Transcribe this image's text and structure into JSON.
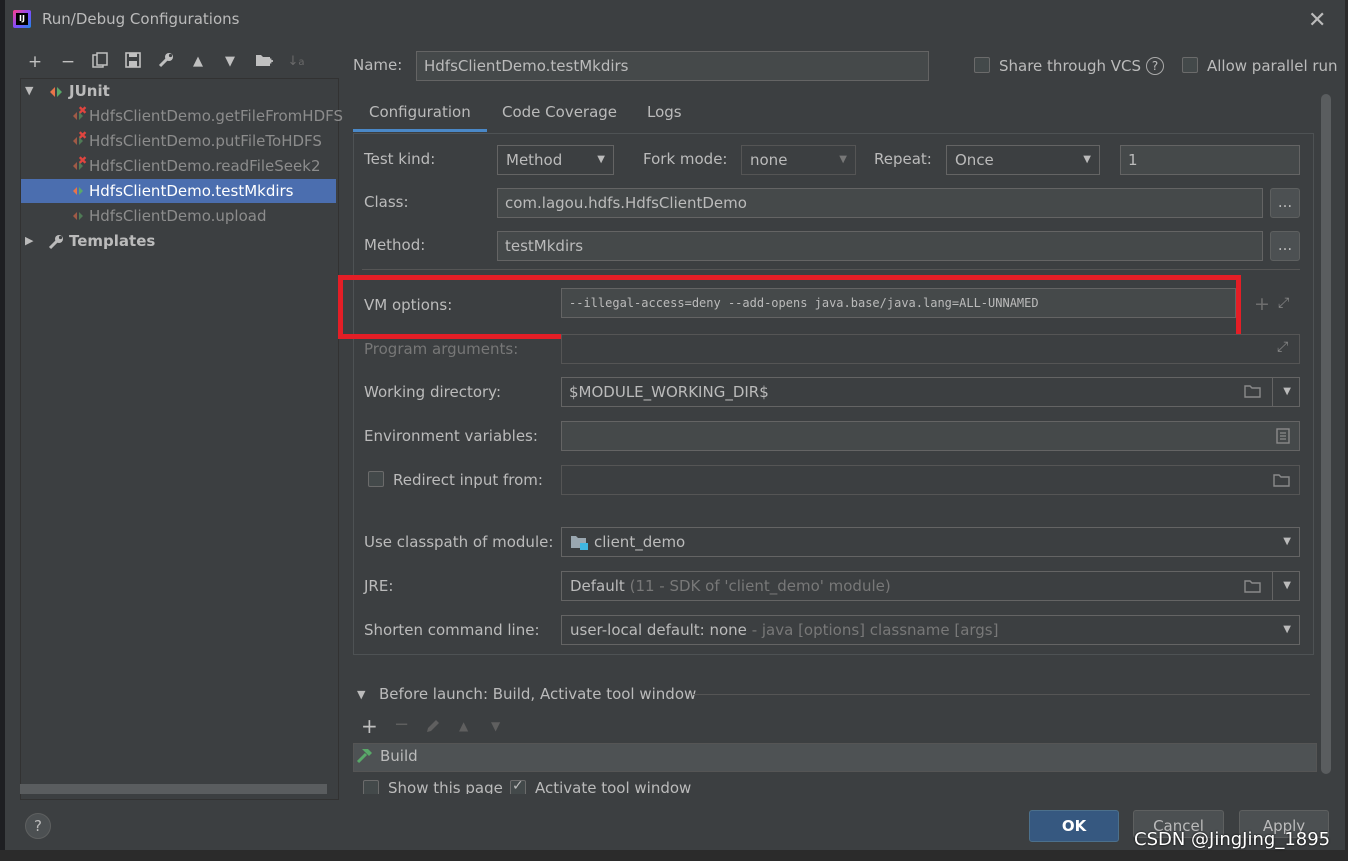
{
  "window": {
    "title": "Run/Debug Configurations",
    "icon": "intellij-idea-icon"
  },
  "toolbar": {
    "icons": [
      "add-icon",
      "remove-icon",
      "copy-icon",
      "save-icon",
      "wrench-icon",
      "move-up-icon",
      "move-down-icon",
      "folder-add-icon",
      "sort-icon"
    ],
    "glyphs": [
      "+",
      "−",
      "⧉",
      "🖫",
      "🔧",
      "▲",
      "▼",
      "📁",
      "↓a"
    ]
  },
  "tree": {
    "junit_label": "JUnit",
    "items": [
      {
        "label": "HdfsClientDemo.getFileFromHDFS",
        "error": true
      },
      {
        "label": "HdfsClientDemo.putFileToHDFS",
        "error": true
      },
      {
        "label": "HdfsClientDemo.readFileSeek2",
        "error": true
      },
      {
        "label": "HdfsClientDemo.testMkdirs",
        "error": false,
        "selected": true
      },
      {
        "label": "HdfsClientDemo.upload",
        "error": false
      }
    ],
    "templates_label": "Templates"
  },
  "header": {
    "name_label": "Name:",
    "name_value": "HdfsClientDemo.testMkdirs",
    "share_vcs_label": "Share through VCS",
    "allow_parallel_label": "Allow parallel run"
  },
  "tabs": [
    {
      "label": "Configuration",
      "active": true
    },
    {
      "label": "Code Coverage",
      "active": false
    },
    {
      "label": "Logs",
      "active": false
    }
  ],
  "config": {
    "test_kind_label": "Test kind:",
    "test_kind_value": "Method",
    "fork_mode_label": "Fork mode:",
    "fork_mode_value": "none",
    "repeat_label": "Repeat:",
    "repeat_value": "Once",
    "repeat_count": "1",
    "class_label": "Class:",
    "class_value": "com.lagou.hdfs.HdfsClientDemo",
    "method_label": "Method:",
    "method_value": "testMkdirs",
    "browse_label": "...",
    "vm_options_label": "VM options:",
    "vm_options_value": "--illegal-access=deny --add-opens java.base/java.lang=ALL-UNNAMED",
    "program_args_label": "Program arguments:",
    "working_dir_label": "Working directory:",
    "working_dir_value": "$MODULE_WORKING_DIR$",
    "env_vars_label": "Environment variables:",
    "redirect_input_label": "Redirect input from:",
    "classpath_label": "Use classpath of module:",
    "classpath_value": "client_demo",
    "jre_label": "JRE:",
    "jre_value": "Default",
    "jre_hint": "(11 - SDK of 'client_demo' module)",
    "shorten_label": "Shorten command line:",
    "shorten_value": "user-local default: none",
    "shorten_hint": "- java [options] classname [args]"
  },
  "before_launch": {
    "title": "Before launch: Build, Activate tool window",
    "task": "Build",
    "show_page_label": "Show this page",
    "activate_label": "Activate tool window"
  },
  "footer": {
    "help": "?",
    "ok": "OK",
    "cancel": "Cancel",
    "apply": "Apply"
  },
  "watermark": "CSDN @JingJing_1895",
  "colors": {
    "dialog_bg": "#3c3f41",
    "selection": "#4b6eaf",
    "highlight_box": "#e41e26",
    "ok_button": "#365880",
    "junit_green": "#59a869",
    "junit_orange": "#e8754a"
  }
}
